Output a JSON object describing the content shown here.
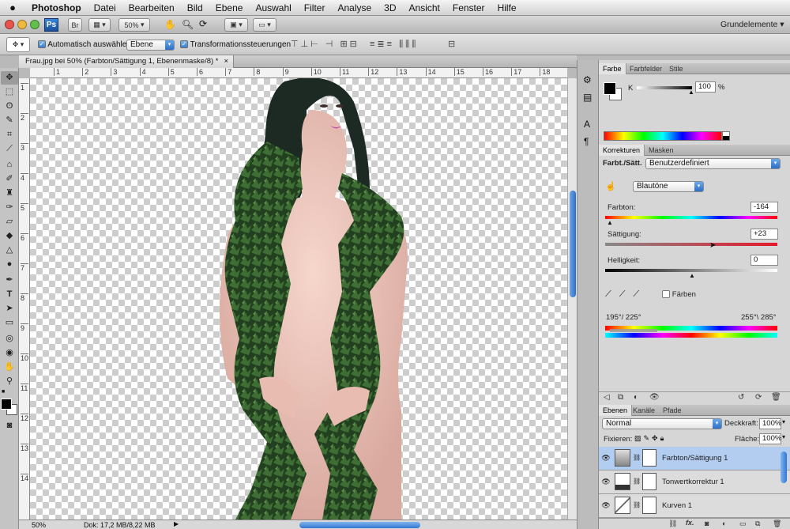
{
  "menubar": {
    "apple": "",
    "items": [
      "Photoshop",
      "Datei",
      "Bearbeiten",
      "Bild",
      "Ebene",
      "Auswahl",
      "Filter",
      "Analyse",
      "3D",
      "Ansicht",
      "Fenster",
      "Hilfe"
    ]
  },
  "appbar": {
    "ps_label": "Ps",
    "br_label": "Br",
    "zoom": "50%",
    "workspace": "Grundelemente"
  },
  "options": {
    "auto_select_label": "Automatisch auswählen:",
    "auto_select_value": "Ebene",
    "transform_label": "Transformationssteuerungen"
  },
  "document": {
    "tab_title": "Frau.jpg bei 50% (Farbton/Sättigung 1, Ebenenmaske/8) *",
    "close": "×",
    "ruler_ticks": [
      "1",
      "2",
      "3",
      "4",
      "5",
      "6",
      "7",
      "8",
      "9",
      "10",
      "11",
      "12",
      "13",
      "14",
      "15",
      "16",
      "17",
      "18"
    ],
    "status_zoom": "50%",
    "status_doc": "Dok: 17,2 MB/8,22 MB"
  },
  "color_panel": {
    "tabs": [
      "Farbe",
      "Farbfelder",
      "Stile"
    ],
    "k_label": "K",
    "k_value": "100",
    "k_unit": "%"
  },
  "adjust_panel": {
    "tabs": [
      "Korrekturen",
      "Masken"
    ],
    "title": "Farbt./Sätt.",
    "preset": "Benutzerdefiniert",
    "range": "Blautöne",
    "hue_label": "Farbton:",
    "hue_value": "-164",
    "sat_label": "Sättigung:",
    "sat_value": "+23",
    "light_label": "Helligkeit:",
    "light_value": "0",
    "colorize_label": "Färben",
    "range_left": "195°/ 225°",
    "range_right": "255°\\ 285°"
  },
  "layers_panel": {
    "tabs": [
      "Ebenen",
      "Kanäle",
      "Pfade"
    ],
    "blend_mode": "Normal",
    "opacity_label": "Deckkraft:",
    "opacity_value": "100%",
    "lock_label": "Fixieren:",
    "fill_label": "Fläche:",
    "fill_value": "100%",
    "layers": [
      {
        "name": "Farbton/Sättigung 1",
        "selected": true
      },
      {
        "name": "Tonwertkorrektur 1",
        "selected": false
      },
      {
        "name": "Kurven 1",
        "selected": false
      }
    ]
  },
  "colors": {
    "selection_blue": "#b3cdf1",
    "accent_blue": "#3d7fd0",
    "hue_slider_red": "#e4182a"
  }
}
